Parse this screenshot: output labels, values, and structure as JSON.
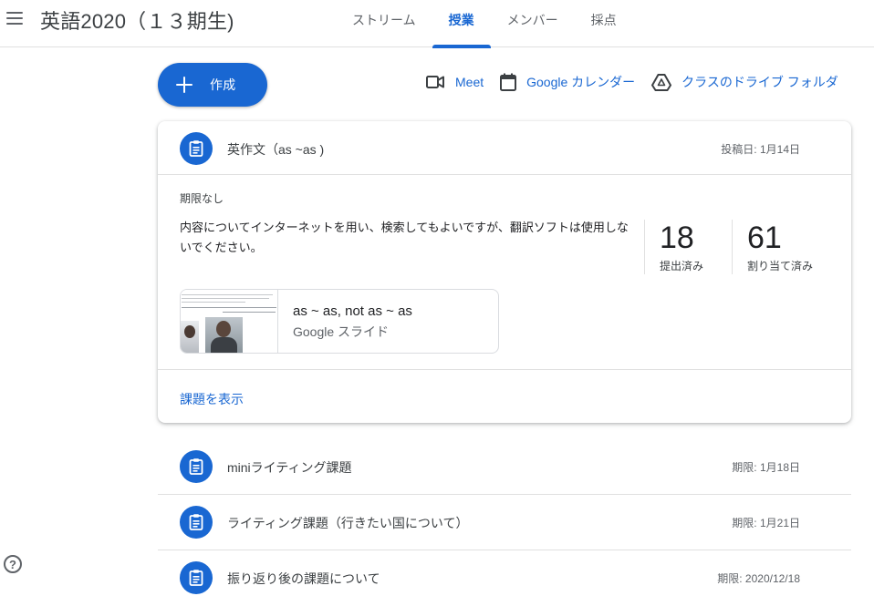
{
  "header": {
    "class_title": "英語2020（１３期生)",
    "tabs": [
      {
        "label": "ストリーム"
      },
      {
        "label": "授業"
      },
      {
        "label": "メンバー"
      },
      {
        "label": "採点"
      }
    ]
  },
  "toolbar": {
    "create_label": "作成",
    "meet_label": "Meet",
    "calendar_label": "Google カレンダー",
    "drive_label": "クラスのドライブ フォルダ"
  },
  "expanded_assignment": {
    "title": "英作文（as ~as )",
    "posted": "投稿日: 1月14日",
    "due": "期限なし",
    "instructions": "内容についてインターネットを用い、検索してもよいですが、翻訳ソフトは使用しないでください。",
    "stats": {
      "turned_in_count": "18",
      "turned_in_label": "提出済み",
      "assigned_count": "61",
      "assigned_label": "割り当て済み"
    },
    "attachment": {
      "title": "as ~ as, not as ~ as",
      "type": "Google スライド"
    },
    "view_link": "課題を表示"
  },
  "assignments": [
    {
      "title": "miniライティング課題",
      "due": "期限: 1月18日"
    },
    {
      "title": "ライティング課題（行きたい国について）",
      "due": "期限: 1月21日"
    },
    {
      "title": "振り返り後の課題について",
      "due": "期限: 2020/12/18"
    }
  ],
  "help": {
    "label": "?"
  },
  "colors": {
    "accent": "#1967d2",
    "text": "#3c4043",
    "divider": "#e0e0e0"
  },
  "icons": {
    "menu": "hamburger-menu-icon",
    "create": "plus-icon",
    "meet": "video-camera-icon",
    "calendar": "calendar-icon",
    "drive": "google-drive-icon",
    "assignment": "assignment-clipboard-icon",
    "help": "help-icon"
  }
}
